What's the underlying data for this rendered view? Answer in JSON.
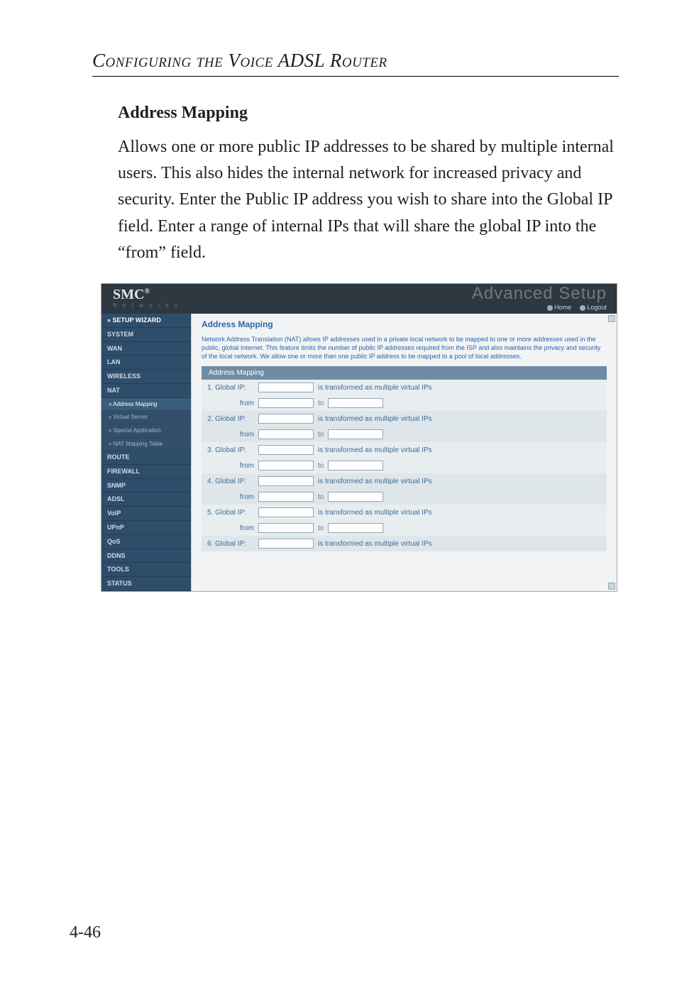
{
  "chapter_title": "Configuring the Voice ADSL Router",
  "section_heading": "Address Mapping",
  "body_paragraph": "Allows one or more public IP addresses to be shared by multiple internal users. This also hides the internal network for increased privacy and security. Enter the Public IP address you wish to share into the Global IP field. Enter a range of internal IPs that will share the global IP into the “from” field.",
  "page_number": "4-46",
  "shot": {
    "brand": "SMC",
    "brand_reg": "®",
    "brand_sub": "N e t w o r k s",
    "title_big": "Advanced Setup",
    "home_label": "Home",
    "logout_label": "Logout",
    "sidebar": {
      "setup_wizard": "» SETUP WIZARD",
      "system": "SYSTEM",
      "wan": "WAN",
      "lan": "LAN",
      "wireless": "WIRELESS",
      "nat": "NAT",
      "addr_mapping_sub": "» Address Mapping",
      "virtual_server_sub": "» Virtual Server",
      "special_app_sub": "» Special Application",
      "nat_mapping_sub": "» NAT Mapping Table",
      "route": "ROUTE",
      "firewall": "FIREWALL",
      "snmp": "SNMP",
      "adsl": "ADSL",
      "voip": "VoIP",
      "upnp": "UPnP",
      "qos": "QoS",
      "ddns": "DDNS",
      "tools": "TOOLS",
      "status": "STATUS"
    },
    "panel": {
      "title": "Address Mapping",
      "desc": "Network Address Translation (NAT) allows IP addresses used in a private local network to be mapped to one or more addresses used in the public, global Internet. This feature limits the number of public IP addresses required from the ISP and also maintains the privacy and security of the local network. We allow one or more than one public IP address to be mapped to a pool of local addresses.",
      "sub": "Address Mapping",
      "transformed_label": "is transformed as multiple virtual IPs",
      "from_label": "from",
      "to_label": "to",
      "rows": [
        {
          "label": "1. Global IP:"
        },
        {
          "label": "2. Global IP:"
        },
        {
          "label": "3. Global IP:"
        },
        {
          "label": "4. Global IP:"
        },
        {
          "label": "5. Global IP:"
        },
        {
          "label": "6. Global IP:"
        }
      ]
    }
  }
}
